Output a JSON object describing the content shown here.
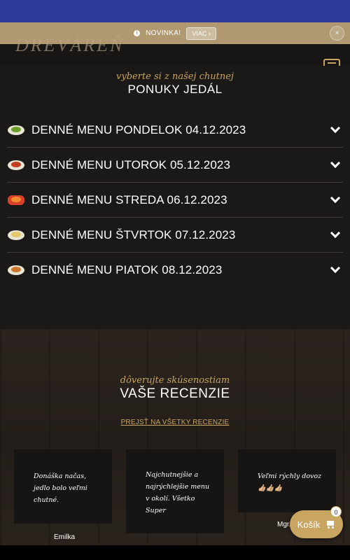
{
  "header": {
    "logo_text": "DREVÁREŇ"
  },
  "notice": {
    "text": "NOVINKA!",
    "more_label": "VIAC ›",
    "close_label": "×"
  },
  "menu_section": {
    "script_title": "vyberte si z našej chutnej",
    "title": "PONUKY JEDÁL",
    "items": [
      {
        "label": "DENNÉ MENU PONDELOK 04.12.2023"
      },
      {
        "label": "DENNÉ MENU UTOROK 05.12.2023"
      },
      {
        "label": "DENNÉ MENU STREDA 06.12.2023"
      },
      {
        "label": "DENNÉ MENU ŠTVRTOK 07.12.2023"
      },
      {
        "label": "DENNÉ MENU PIATOK 08.12.2023"
      }
    ]
  },
  "reviews": {
    "script_title": "dôverujte skúsenostiam",
    "title": "VAŠE RECENZIE",
    "all_link": "PREJSŤ NA VŠETKY RECENZIE",
    "cards": [
      {
        "text": "Donáška načas, jedlo bolo veľmi chutné.",
        "author": "Emilka"
      },
      {
        "text": "Najchutnejšie a najrýchlejšie menu v okolí. Všetko Super",
        "author": ""
      },
      {
        "text": "Veľmi rýchly dovoz 👍🏼👍🏼👍🏼",
        "author": "Mgr."
      }
    ]
  },
  "cart": {
    "label": "Košík",
    "count": "0"
  },
  "colors": {
    "accent": "#c8a560",
    "topbar": "#2c3c98",
    "background": "#1b1917"
  }
}
